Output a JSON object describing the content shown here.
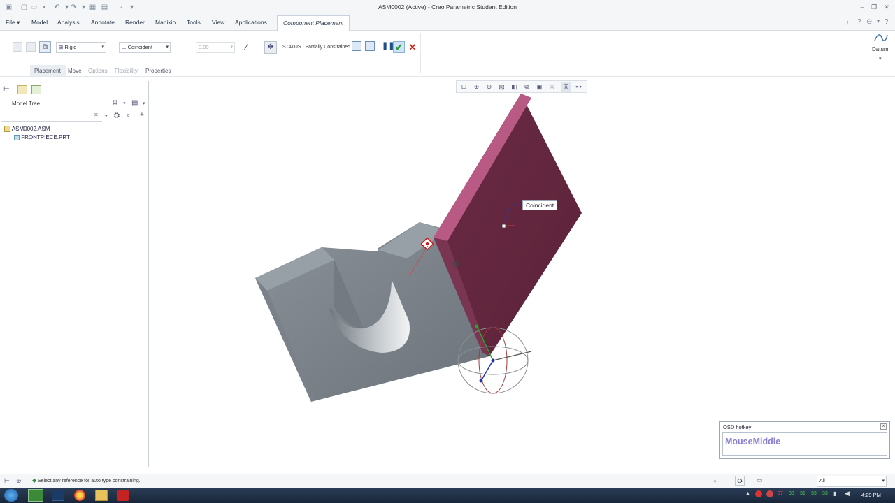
{
  "window": {
    "title": "ASM0002 (Active) - Creo Parametric Student Edition"
  },
  "tabs": {
    "file": "File",
    "model": "Model",
    "analysis": "Analysis",
    "annotate": "Annotate",
    "render": "Render",
    "manikin": "Manikin",
    "tools": "Tools",
    "view": "View",
    "applications": "Applications",
    "component_placement": "Component Placement"
  },
  "ribbon": {
    "constraint_set": "Rigid",
    "constraint_type": "Coincident",
    "offset_value": "0.00",
    "status": "STATUS : Partially Constrained",
    "datum_label": "Datum"
  },
  "subtabs": {
    "placement": "Placement",
    "move": "Move",
    "options": "Options",
    "flexibility": "Flexibility",
    "properties": "Properties"
  },
  "model_tree": {
    "header": "Model Tree",
    "items": [
      {
        "label": "ASM0002.ASM",
        "icon": "assembly-icon"
      },
      {
        "label": "FRONTPIECE.PRT",
        "icon": "part-icon"
      }
    ]
  },
  "graphics": {
    "constraint_label": "Coincident",
    "colors": {
      "part_gray": "#7d858c",
      "placed_part": "#6b2a44",
      "placed_edge": "#b85a84"
    }
  },
  "osd": {
    "title": "OSD hotkey",
    "key": "MouseMiddle"
  },
  "statusbar": {
    "message": "Select any reference for auto type constraining.",
    "filter": "All"
  },
  "taskbar": {
    "clock": "4:29 PM"
  }
}
